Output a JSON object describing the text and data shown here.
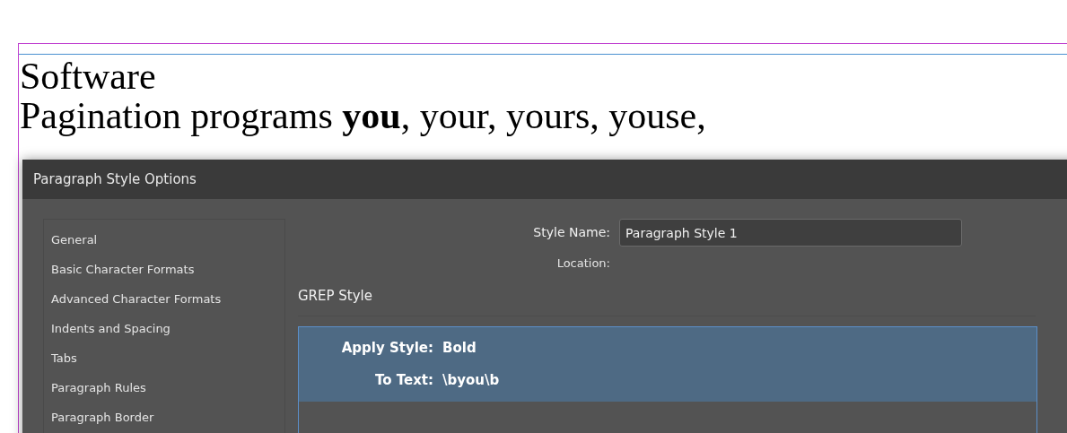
{
  "document": {
    "lines": [
      {
        "text": "Software"
      },
      {
        "text": "Pagination programs **you**, your, yours, youse,"
      }
    ]
  },
  "dialog": {
    "title": "Paragraph Style Options",
    "sidebar": {
      "items": [
        {
          "label": "General"
        },
        {
          "label": "Basic Character Formats"
        },
        {
          "label": "Advanced Character Formats"
        },
        {
          "label": "Indents and Spacing"
        },
        {
          "label": "Tabs"
        },
        {
          "label": "Paragraph Rules"
        },
        {
          "label": "Paragraph Border"
        }
      ]
    },
    "style_name": {
      "label": "Style Name:",
      "value": "Paragraph Style 1"
    },
    "location": {
      "label": "Location:"
    },
    "section_title": "GREP Style",
    "grep_rules": [
      {
        "apply_label": "Apply Style:",
        "style": "Bold",
        "to_label": "To Text:",
        "pattern": "\\byou\\b",
        "selected": true
      }
    ]
  }
}
